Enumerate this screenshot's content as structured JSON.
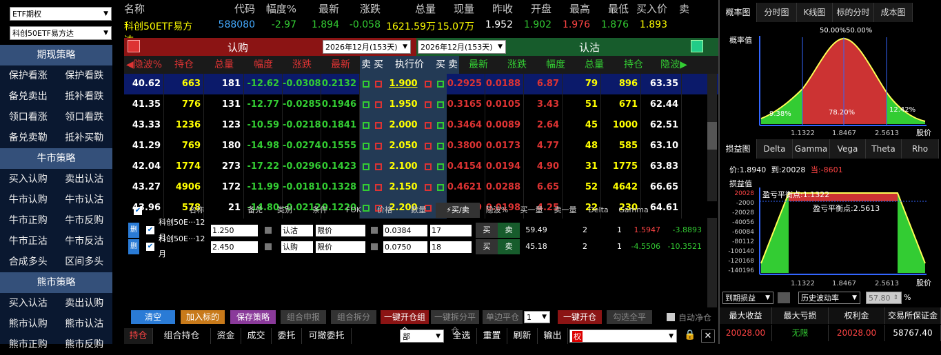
{
  "top_selects": {
    "category": "ETF期权",
    "underlying": "科创50ETF易方达"
  },
  "sidebar": [
    {
      "section": "期现策略",
      "rows": [
        [
          "保护看涨",
          "保护看跌"
        ],
        [
          "备兑卖出",
          "抵补看跌"
        ],
        [
          "领口看涨",
          "领口看跌"
        ],
        [
          "备兑卖勒",
          "抵补买勒"
        ]
      ]
    },
    {
      "section": "牛市策略",
      "rows": [
        [
          "买入认购",
          "卖出认沽"
        ],
        [
          "牛市认购",
          "牛市认沽"
        ],
        [
          "牛市正购",
          "牛市反购"
        ],
        [
          "牛市正沽",
          "牛市反沽"
        ],
        [
          "合成多头",
          "区间多头"
        ]
      ]
    },
    {
      "section": "熊市策略",
      "rows": [
        [
          "买入认沽",
          "卖出认购"
        ],
        [
          "熊市认购",
          "熊市认沽"
        ],
        [
          "熊市正购",
          "熊市反购"
        ]
      ]
    }
  ],
  "quote": {
    "headers": [
      "名称",
      "代码",
      "幅度%",
      "最新",
      "涨跌",
      "总量",
      "现量",
      "昨收",
      "开盘",
      "最高",
      "最低",
      "买入价",
      "卖"
    ],
    "values": [
      "科创50ETF易方达",
      "588080",
      "-2.97",
      "1.894",
      "-0.058",
      "1621.59万",
      "15.07万",
      "1.952",
      "1.902",
      "1.976",
      "1.876",
      "1.893",
      ""
    ]
  },
  "call_label": "认购",
  "put_label": "认沽",
  "expiry_left": "2026年12月(153天)",
  "expiry_right": "2026年12月(153天)",
  "chain_headers": [
    "◀隐波%",
    "持仓",
    "总量",
    "幅度",
    "涨跌",
    "最新",
    "卖",
    "买",
    "执行价",
    "买",
    "卖",
    "最新",
    "涨跌",
    "幅度",
    "总量",
    "持仓",
    "隐波▶"
  ],
  "chain_rows": [
    {
      "c": [
        "40.62",
        "663",
        "181",
        "-12.62",
        "-0.0308",
        "0.2132"
      ],
      "k": "1.900",
      "p": [
        "0.2925",
        "0.0188",
        "6.87",
        "79",
        "896",
        "63.35"
      ]
    },
    {
      "c": [
        "41.35",
        "776",
        "131",
        "-12.77",
        "-0.0285",
        "0.1946"
      ],
      "k": "1.950",
      "p": [
        "0.3165",
        "0.0105",
        "3.43",
        "51",
        "671",
        "62.44"
      ]
    },
    {
      "c": [
        "43.33",
        "1236",
        "123",
        "-10.59",
        "-0.0218",
        "0.1841"
      ],
      "k": "2.000",
      "p": [
        "0.3464",
        "0.0089",
        "2.64",
        "45",
        "1000",
        "62.51"
      ]
    },
    {
      "c": [
        "41.29",
        "769",
        "180",
        "-14.98",
        "-0.0274",
        "0.1555"
      ],
      "k": "2.050",
      "p": [
        "0.3800",
        "0.0173",
        "4.77",
        "48",
        "585",
        "63.10"
      ]
    },
    {
      "c": [
        "42.04",
        "1774",
        "273",
        "-17.22",
        "-0.0296",
        "0.1423"
      ],
      "k": "2.100",
      "p": [
        "0.4154",
        "0.0194",
        "4.90",
        "31",
        "1775",
        "63.83"
      ]
    },
    {
      "c": [
        "43.27",
        "4906",
        "172",
        "-11.99",
        "-0.0181",
        "0.1328"
      ],
      "k": "2.150",
      "p": [
        "0.4621",
        "0.0288",
        "6.65",
        "52",
        "4642",
        "66.65"
      ]
    },
    {
      "c": [
        "43.96",
        "578",
        "21",
        "-14.80",
        "-0.0212",
        "0.1220"
      ],
      "k": "2.200",
      "p": [
        "0.4859",
        "0.0198",
        "4.25",
        "22",
        "230",
        "64.61"
      ]
    }
  ],
  "legs_headers": [
    "名称",
    "备兑",
    "类别",
    "条件",
    "FOK",
    "价格",
    "数量",
    "⚡买/卖",
    "隐波%",
    "买一量",
    "卖一量",
    "Delta",
    "Gamma"
  ],
  "legs": [
    {
      "del": "删",
      "name": "科创50E···12月",
      "strike": "1.250",
      "type": "认沽",
      "cond": "限价",
      "price": "0.0384",
      "qty": "17",
      "buy": "买",
      "sell": "卖",
      "iv": "59.49",
      "b1": "2",
      "s1": "1",
      "delta": "1.5947",
      "gamma": "-3.8893"
    },
    {
      "del": "删",
      "name": "科创50E···12月",
      "strike": "2.450",
      "type": "认购",
      "cond": "限价",
      "price": "0.0750",
      "qty": "18",
      "buy": "买",
      "sell": "卖",
      "iv": "45.18",
      "b1": "2",
      "s1": "1",
      "delta": "-4.5506",
      "gamma": "-10.3521"
    }
  ],
  "buttons": {
    "clear": "清空",
    "add": "加入标的",
    "save": "保存策略",
    "combo_report": "组合申报",
    "combo_split": "组合拆分",
    "one_open_combo": "一键开仓组合",
    "one_split_close": "一键拆分平仓",
    "single_close": "单边平仓",
    "qty": "1",
    "one_open": "一键开仓",
    "check_all_close": "勾选全平",
    "auto_close": "自动净仓"
  },
  "bottom_tabs": [
    "持仓",
    "组合持仓",
    "资金",
    "成交",
    "委托",
    "可撤委托"
  ],
  "bottom_select": "部",
  "bottom_actions": [
    "全选",
    "重置",
    "刷新",
    "输出"
  ],
  "bottom_input": "权",
  "right_tabs_top": [
    "概率图",
    "分时图",
    "K线图",
    "标的分时",
    "成本图"
  ],
  "prob": {
    "title": "概率值",
    "top": "50.00%50.00%",
    "left_pct": "9.38%",
    "mid_pct": "78.20%",
    "right_pct": "12.42%",
    "x_ticks": [
      "1.1322",
      "1.8467",
      "2.5613"
    ],
    "x_label": "股价"
  },
  "right_tabs_mid": [
    "损益图",
    "Delta",
    "Gamma",
    "Vega",
    "Theta",
    "Rho"
  ],
  "pnl": {
    "price_label": "价:1.8940",
    "to_label": "到:20028",
    "cur_label": "当:-8601",
    "title": "损益值",
    "y_ticks": [
      "20028",
      "-2000",
      "-20028",
      "-40056",
      "-60084",
      "-80112",
      "-100140",
      "-120168",
      "-140196"
    ],
    "be1": "盈亏平衡点:1.1322",
    "be2": "盈亏平衡点:2.5613",
    "x_ticks": [
      "1.1322",
      "1.8467",
      "2.5613"
    ],
    "x_label": "股价"
  },
  "pnl_controls": {
    "mode": "到期损益",
    "vol": "历史波动率",
    "vol_value": "57.80",
    "pct": "%"
  },
  "summary": {
    "headers": [
      "最大收益",
      "最大亏损",
      "权利金",
      "交易所保证金"
    ],
    "values": [
      "20028.00",
      "无限",
      "20028.00",
      "58767.40"
    ]
  }
}
